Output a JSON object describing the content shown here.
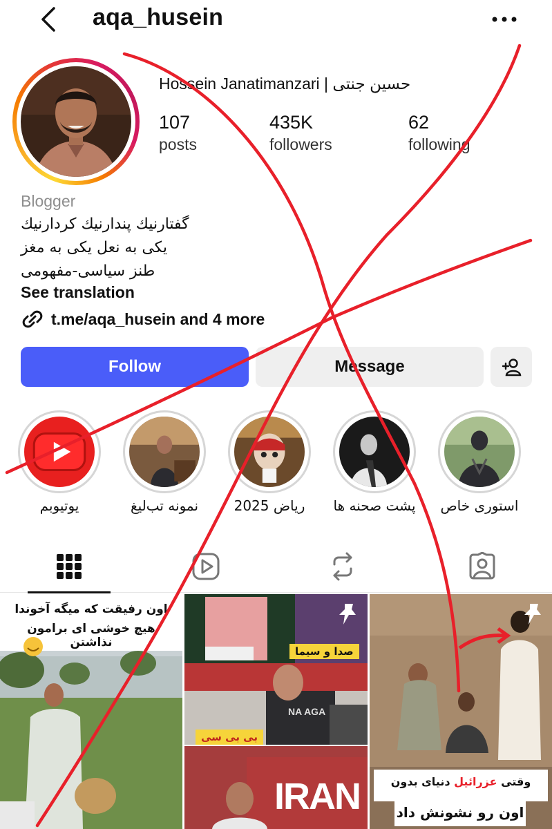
{
  "header": {
    "username": "aqa_husein"
  },
  "profile": {
    "full_name": "Hossein Janatimanzari | حسین جنتی",
    "stats": [
      {
        "value": "107",
        "label": "posts"
      },
      {
        "value": "435K",
        "label": "followers"
      },
      {
        "value": "62",
        "label": "following"
      }
    ],
    "category": "Blogger",
    "bio_lines": [
      "گفتارنیك پندارنیك كردارنیك",
      "یکی به نعل یکی به مغز",
      "طنز سیاسی-مفهومی"
    ],
    "see_translation": "See translation",
    "link": "t.me/aqa_husein and 4 more"
  },
  "actions": {
    "follow": "Follow",
    "message": "Message"
  },
  "highlights": [
    {
      "label": "یوتیوبم"
    },
    {
      "label": "نمونه تب‌لیغ"
    },
    {
      "label": "ریاض 2025"
    },
    {
      "label": "پشت صحنه ها"
    },
    {
      "label": "استوری خاص"
    }
  ],
  "posts": {
    "tile1_caption_line1": "اون رفیقت که میگه آخوندا",
    "tile1_caption_line2": "هیچ خوشی ای برامون نذاشتن",
    "tile2_label_top": "صدا و سیما",
    "tile2_label_mid": "بی بی سی",
    "tile2_screen_text": "IRAN",
    "tile2_shirt_text": "NA AGA",
    "tile3_caption_line1_a": "وقتی",
    "tile3_caption_line1_b": "عزرائیل",
    "tile3_caption_line1_c": "دنیای بدون",
    "tile3_caption_line2": "اون رو نشونش داد"
  },
  "colors": {
    "follow_blue": "#4a5df9",
    "secondary_btn": "#efefef",
    "muted_text": "#8e8e8e",
    "annotation_red": "#e8202a"
  }
}
